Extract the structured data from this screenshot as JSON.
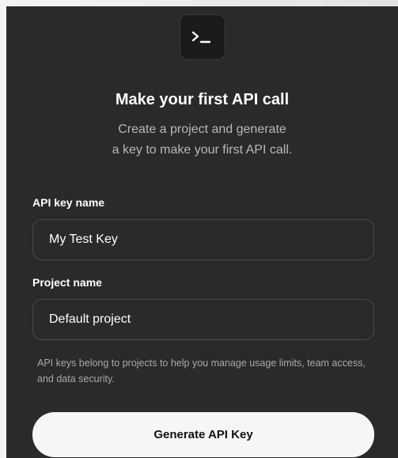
{
  "header": {
    "icon": "terminal-icon",
    "title": "Make your first API call",
    "subtitle_line1": "Create a project and generate",
    "subtitle_line2": "a key to make your first API call."
  },
  "form": {
    "api_key_label": "API key name",
    "api_key_value": "My Test Key",
    "project_label": "Project name",
    "project_value": "Default project",
    "help_text": "API keys belong to projects to help you manage usage limits, team access, and data security.",
    "submit_label": "Generate API Key"
  },
  "colors": {
    "card_background": "#2a2a2b",
    "button_background": "#f6f6f6",
    "muted_text": "#b8b8bb"
  }
}
